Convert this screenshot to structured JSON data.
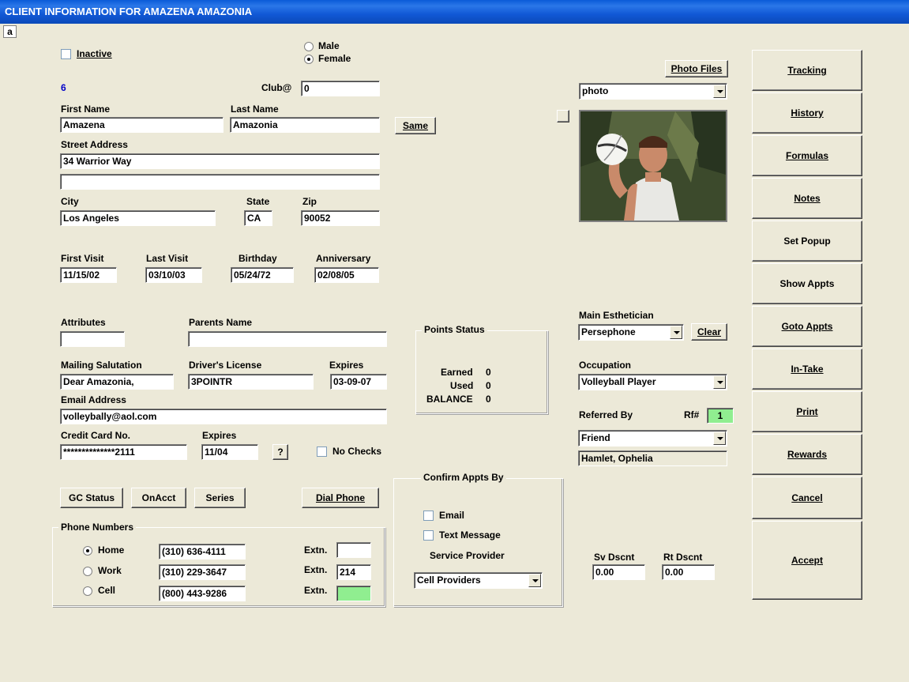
{
  "window": {
    "title": "CLIENT INFORMATION FOR AMAZENA AMAZONIA",
    "tab_label": "a"
  },
  "client": {
    "inactive_label": "Inactive",
    "inactive": false,
    "gender_options": [
      "Male",
      "Female"
    ],
    "gender": "Female",
    "id": "6",
    "club_label": "Club@",
    "club": "0",
    "first_name_label": "First Name",
    "first_name": "Amazena",
    "last_name_label": "Last Name",
    "last_name": "Amazonia",
    "same_button": "Same",
    "street_label": "Street Address",
    "street1": "34 Warrior Way",
    "street2": "",
    "city_label": "City",
    "city": "Los Angeles",
    "state_label": "State",
    "state": "CA",
    "zip_label": "Zip",
    "zip": "90052",
    "first_visit_label": "First Visit",
    "first_visit": "11/15/02",
    "last_visit_label": "Last Visit",
    "last_visit": "03/10/03",
    "birthday_label": "Birthday",
    "birthday": "05/24/72",
    "anniversary_label": "Anniversary",
    "anniversary": "02/08/05",
    "attributes_label": "Attributes",
    "attributes": "",
    "parents_label": "Parents Name",
    "parents": "",
    "salutation_label": "Mailing Salutation",
    "salutation": "Dear Amazonia,",
    "license_label": "Driver's License",
    "license": "3POINTR",
    "license_expires_label": "Expires",
    "license_expires": "03-09-07",
    "email_label": "Email Address",
    "email": "volleybally@aol.com",
    "cc_label": "Credit Card No.",
    "cc": "**************2111",
    "cc_expires_label": "Expires",
    "cc_expires": "11/04",
    "help_button": "?",
    "no_checks_label": "No Checks",
    "no_checks": false
  },
  "actions": {
    "gc_status": "GC Status",
    "onacct": "OnAcct",
    "series": "Series",
    "dial_phone": "Dial Phone"
  },
  "phones": {
    "caption": "Phone Numbers",
    "extn_label": "Extn.",
    "rows": [
      {
        "label": "Home",
        "number": "(310) 636-4111",
        "extn": "",
        "selected": true
      },
      {
        "label": "Work",
        "number": "(310) 229-3647",
        "extn": "214",
        "selected": false
      },
      {
        "label": "Cell",
        "number": "(800) 443-9286",
        "extn": "",
        "selected": false
      }
    ]
  },
  "points": {
    "caption": "Points Status",
    "earned_label": "Earned",
    "earned": "0",
    "used_label": "Used",
    "used": "0",
    "balance_label": "BALANCE",
    "balance": "0"
  },
  "confirm": {
    "caption": "Confirm Appts By",
    "email_label": "Email",
    "text_label": "Text Message",
    "provider_label": "Service Provider",
    "provider": "Cell Providers"
  },
  "photo": {
    "files_button": "Photo Files",
    "selected": "photo"
  },
  "right": {
    "esthetician_label": "Main Esthetician",
    "esthetician": "Persephone",
    "clear_button": "Clear",
    "occupation_label": "Occupation",
    "occupation": "Volleyball Player",
    "referred_label": "Referred By",
    "rf_label": "Rf#",
    "rf": "1",
    "referred": "Friend",
    "referred_name": "Hamlet, Ophelia",
    "sv_label": "Sv Dscnt",
    "sv": "0.00",
    "rt_label": "Rt Dscnt",
    "rt": "0.00"
  },
  "sidebar": {
    "tracking": "Tracking",
    "history": "History",
    "formulas": "Formulas",
    "notes": "Notes",
    "popup": "Set Popup",
    "show_appts": "Show Appts",
    "goto_appts": "Goto Appts",
    "intake": "In-Take",
    "print": "Print",
    "rewards": "Rewards",
    "cancel": "Cancel",
    "accept": "Accept"
  },
  "colors": {
    "title_bar": "#0A5AD8",
    "dialog_bg": "#ECE9D8",
    "highlight_field": "#90EE90",
    "id_text": "#0000C8"
  }
}
